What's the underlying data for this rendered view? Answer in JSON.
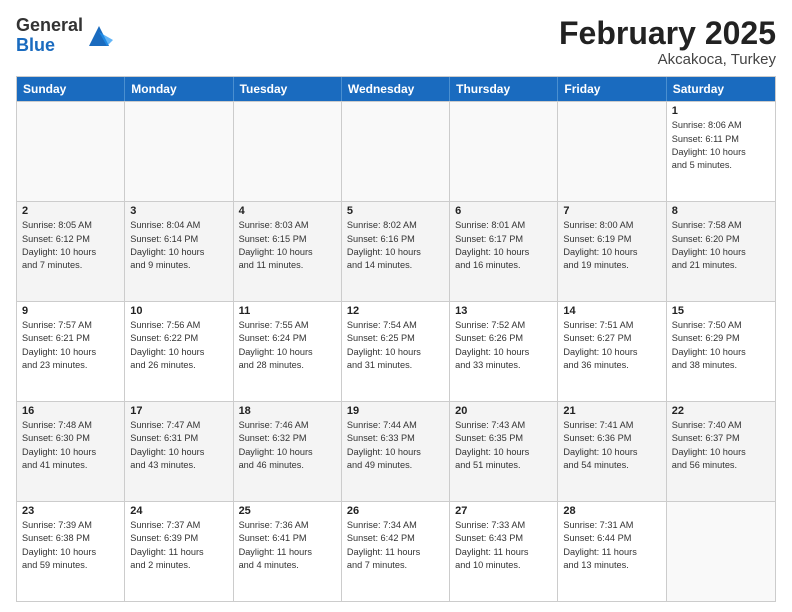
{
  "header": {
    "logo_general": "General",
    "logo_blue": "Blue",
    "title": "February 2025",
    "subtitle": "Akcakoca, Turkey"
  },
  "days_of_week": [
    "Sunday",
    "Monday",
    "Tuesday",
    "Wednesday",
    "Thursday",
    "Friday",
    "Saturday"
  ],
  "weeks": [
    [
      {
        "day": "",
        "info": ""
      },
      {
        "day": "",
        "info": ""
      },
      {
        "day": "",
        "info": ""
      },
      {
        "day": "",
        "info": ""
      },
      {
        "day": "",
        "info": ""
      },
      {
        "day": "",
        "info": ""
      },
      {
        "day": "1",
        "info": "Sunrise: 8:06 AM\nSunset: 6:11 PM\nDaylight: 10 hours\nand 5 minutes."
      }
    ],
    [
      {
        "day": "2",
        "info": "Sunrise: 8:05 AM\nSunset: 6:12 PM\nDaylight: 10 hours\nand 7 minutes."
      },
      {
        "day": "3",
        "info": "Sunrise: 8:04 AM\nSunset: 6:14 PM\nDaylight: 10 hours\nand 9 minutes."
      },
      {
        "day": "4",
        "info": "Sunrise: 8:03 AM\nSunset: 6:15 PM\nDaylight: 10 hours\nand 11 minutes."
      },
      {
        "day": "5",
        "info": "Sunrise: 8:02 AM\nSunset: 6:16 PM\nDaylight: 10 hours\nand 14 minutes."
      },
      {
        "day": "6",
        "info": "Sunrise: 8:01 AM\nSunset: 6:17 PM\nDaylight: 10 hours\nand 16 minutes."
      },
      {
        "day": "7",
        "info": "Sunrise: 8:00 AM\nSunset: 6:19 PM\nDaylight: 10 hours\nand 19 minutes."
      },
      {
        "day": "8",
        "info": "Sunrise: 7:58 AM\nSunset: 6:20 PM\nDaylight: 10 hours\nand 21 minutes."
      }
    ],
    [
      {
        "day": "9",
        "info": "Sunrise: 7:57 AM\nSunset: 6:21 PM\nDaylight: 10 hours\nand 23 minutes."
      },
      {
        "day": "10",
        "info": "Sunrise: 7:56 AM\nSunset: 6:22 PM\nDaylight: 10 hours\nand 26 minutes."
      },
      {
        "day": "11",
        "info": "Sunrise: 7:55 AM\nSunset: 6:24 PM\nDaylight: 10 hours\nand 28 minutes."
      },
      {
        "day": "12",
        "info": "Sunrise: 7:54 AM\nSunset: 6:25 PM\nDaylight: 10 hours\nand 31 minutes."
      },
      {
        "day": "13",
        "info": "Sunrise: 7:52 AM\nSunset: 6:26 PM\nDaylight: 10 hours\nand 33 minutes."
      },
      {
        "day": "14",
        "info": "Sunrise: 7:51 AM\nSunset: 6:27 PM\nDaylight: 10 hours\nand 36 minutes."
      },
      {
        "day": "15",
        "info": "Sunrise: 7:50 AM\nSunset: 6:29 PM\nDaylight: 10 hours\nand 38 minutes."
      }
    ],
    [
      {
        "day": "16",
        "info": "Sunrise: 7:48 AM\nSunset: 6:30 PM\nDaylight: 10 hours\nand 41 minutes."
      },
      {
        "day": "17",
        "info": "Sunrise: 7:47 AM\nSunset: 6:31 PM\nDaylight: 10 hours\nand 43 minutes."
      },
      {
        "day": "18",
        "info": "Sunrise: 7:46 AM\nSunset: 6:32 PM\nDaylight: 10 hours\nand 46 minutes."
      },
      {
        "day": "19",
        "info": "Sunrise: 7:44 AM\nSunset: 6:33 PM\nDaylight: 10 hours\nand 49 minutes."
      },
      {
        "day": "20",
        "info": "Sunrise: 7:43 AM\nSunset: 6:35 PM\nDaylight: 10 hours\nand 51 minutes."
      },
      {
        "day": "21",
        "info": "Sunrise: 7:41 AM\nSunset: 6:36 PM\nDaylight: 10 hours\nand 54 minutes."
      },
      {
        "day": "22",
        "info": "Sunrise: 7:40 AM\nSunset: 6:37 PM\nDaylight: 10 hours\nand 56 minutes."
      }
    ],
    [
      {
        "day": "23",
        "info": "Sunrise: 7:39 AM\nSunset: 6:38 PM\nDaylight: 10 hours\nand 59 minutes."
      },
      {
        "day": "24",
        "info": "Sunrise: 7:37 AM\nSunset: 6:39 PM\nDaylight: 11 hours\nand 2 minutes."
      },
      {
        "day": "25",
        "info": "Sunrise: 7:36 AM\nSunset: 6:41 PM\nDaylight: 11 hours\nand 4 minutes."
      },
      {
        "day": "26",
        "info": "Sunrise: 7:34 AM\nSunset: 6:42 PM\nDaylight: 11 hours\nand 7 minutes."
      },
      {
        "day": "27",
        "info": "Sunrise: 7:33 AM\nSunset: 6:43 PM\nDaylight: 11 hours\nand 10 minutes."
      },
      {
        "day": "28",
        "info": "Sunrise: 7:31 AM\nSunset: 6:44 PM\nDaylight: 11 hours\nand 13 minutes."
      },
      {
        "day": "",
        "info": ""
      }
    ]
  ]
}
